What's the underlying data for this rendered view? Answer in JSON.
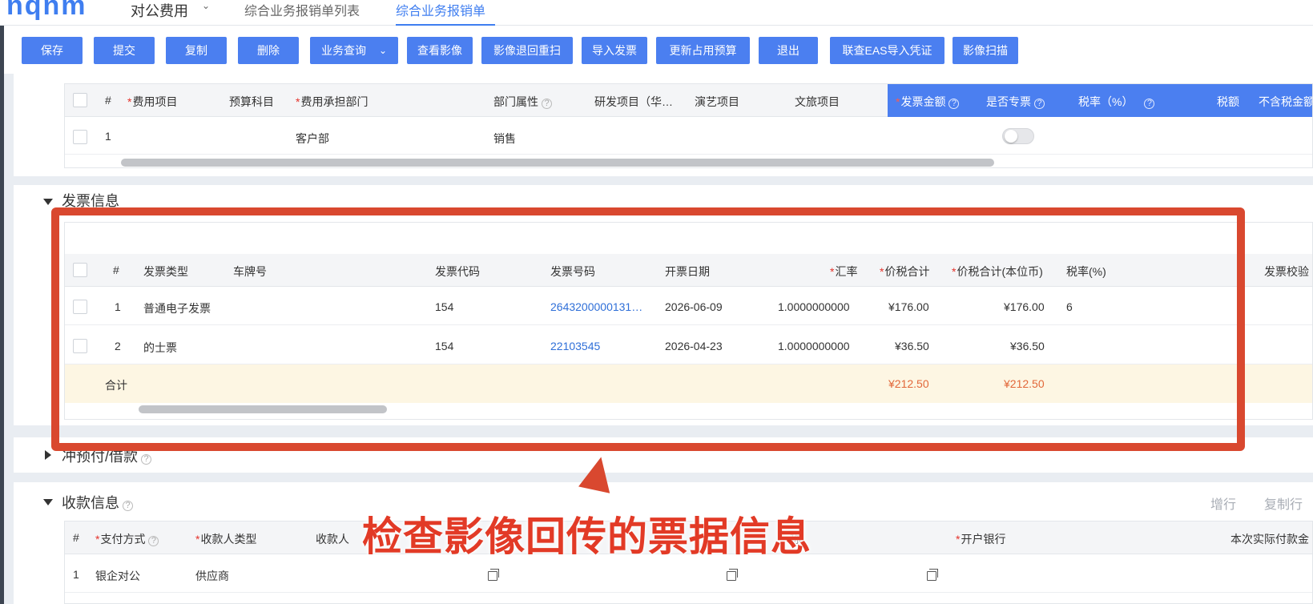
{
  "header": {
    "logo": "nqnm",
    "app_name": "对公费用",
    "tabs": [
      {
        "label": "综合业务报销单列表"
      },
      {
        "label": "综合业务报销单"
      }
    ]
  },
  "toolbar": {
    "buttons": [
      {
        "label": "保存"
      },
      {
        "label": "提交"
      },
      {
        "label": "复制"
      },
      {
        "label": "删除"
      },
      {
        "label": "业务查询"
      },
      {
        "label": "查看影像"
      },
      {
        "label": "影像退回重扫"
      },
      {
        "label": "导入发票"
      },
      {
        "label": "更新占用预算"
      },
      {
        "label": "退出"
      },
      {
        "label": "联查EAS导入凭证"
      },
      {
        "label": "影像扫描"
      }
    ]
  },
  "expense_grid": {
    "columns": [
      "#",
      "费用项目",
      "预算科目",
      "费用承担部门",
      "部门属性",
      "研发项目（华…",
      "演艺项目",
      "文旅项目",
      "发票金额",
      "是否专票",
      "税率（%）",
      "税额",
      "不含税金额"
    ],
    "rows": [
      {
        "index": "1",
        "dept": "客户部",
        "dept_attr": "销售"
      }
    ],
    "accent_color": "#4b7ff0"
  },
  "invoice_section": {
    "title": "发票信息",
    "columns": [
      "#",
      "发票类型",
      "车牌号",
      "发票代码",
      "发票号码",
      "开票日期",
      "汇率",
      "价税合计",
      "价税合计(本位币)",
      "税率(%)",
      "发票校验"
    ],
    "rows": [
      {
        "index": "1",
        "type": "普通电子发票",
        "plate": "",
        "code": "154",
        "number": "2643200000131…",
        "date": "2026-06-09",
        "rate": "1.0000000000",
        "total": "¥176.00",
        "total_base": "¥176.00",
        "tax_rate": "6"
      },
      {
        "index": "2",
        "type": "的士票",
        "plate": "",
        "code": "154",
        "number": "22103545",
        "date": "2026-04-23",
        "rate": "1.0000000000",
        "total": "¥36.50",
        "total_base": "¥36.50",
        "tax_rate": ""
      }
    ],
    "summary": {
      "label": "合计",
      "total": "¥212.50",
      "total_base": "¥212.50"
    }
  },
  "prepay_section": {
    "title": "冲预付/借款"
  },
  "payee_section": {
    "title": "收款信息",
    "actions": [
      "增行",
      "复制行"
    ],
    "columns": [
      "#",
      "支付方式",
      "收款人类型",
      "收款人",
      "称",
      "开户银行",
      "本次实际付款金"
    ],
    "rows": [
      {
        "index": "1",
        "method": "银企对公",
        "payee_type": "供应商"
      }
    ]
  },
  "annotation": {
    "text": "检查影像回传的票据信息",
    "color": "#d9482f"
  }
}
